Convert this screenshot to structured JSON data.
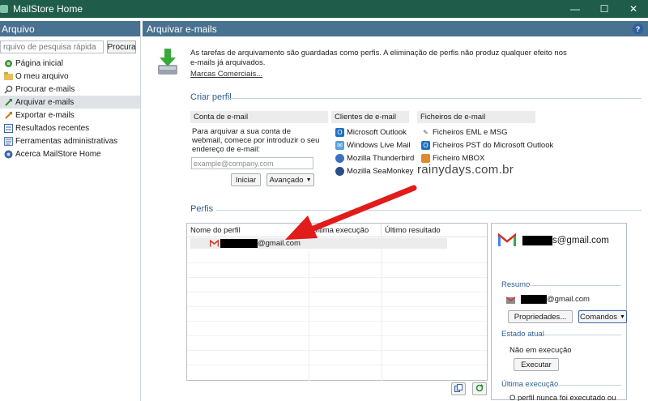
{
  "window": {
    "title": "MailStore Home",
    "controls": [
      "—",
      "☐",
      "✕"
    ]
  },
  "left": {
    "header": "Arquivo",
    "search": {
      "placeholder": "rquivo de pesquisa rápida",
      "button": "Procura"
    },
    "nav": [
      {
        "label": "Página inicial",
        "icon": "home-icon",
        "selected": false
      },
      {
        "label": "O meu arquivo",
        "icon": "folder-icon",
        "selected": false
      },
      {
        "label": "Procurar e-mails",
        "icon": "search-icon",
        "selected": false
      },
      {
        "label": "Arquivar e-mails",
        "icon": "archive-icon",
        "selected": true
      },
      {
        "label": "Exportar e-mails",
        "icon": "export-icon",
        "selected": false
      },
      {
        "label": "Resultados recentes",
        "icon": "results-icon",
        "selected": false
      },
      {
        "label": "Ferramentas administrativas",
        "icon": "tools-icon",
        "selected": false
      },
      {
        "label": "Acerca MailStore Home",
        "icon": "info-icon",
        "selected": false
      }
    ]
  },
  "main": {
    "header": "Arquivar e-mails",
    "help": "?",
    "intro": "As tarefas de arquivamento são guardadas como perfis. A eliminação de perfis não produz qualquer efeito nos e-mails já arquivados.",
    "trademark_link": "Marcas Comerciais...",
    "create_profile": {
      "title": "Criar perfil",
      "webmail": {
        "header": "Conta de e-mail",
        "text": "Para arquivar a sua conta de webmail, comece por introduzir o seu endereço de e-mail:",
        "placeholder": "example@company.com",
        "start": "Iniciar",
        "advanced": "Avançado"
      },
      "clients": {
        "header": "Clientes de e-mail",
        "items": [
          "Microsoft Outlook",
          "Windows Live Mail",
          "Mozilla Thunderbird",
          "Mozilla SeaMonkey"
        ]
      },
      "files": {
        "header": "Ficheiros de e-mail",
        "items": [
          "Ficheiros EML e MSG",
          "Ficheiros PST do Microsoft Outlook",
          "Ficheiro MBOX"
        ]
      }
    },
    "watermark": "rainydays.com.br",
    "profiles": {
      "title": "Perfis",
      "columns": [
        "Nome do perfil",
        "Última execução",
        "Último resultado"
      ],
      "rows": [
        {
          "name_suffix": "@gmail.com"
        }
      ]
    },
    "detail": {
      "title_suffix": "s@gmail.com",
      "summary_title": "Resumo",
      "summary_account_suffix": "@gmail.com",
      "properties": "Propriedades...",
      "commands": "Comandos",
      "state_title": "Estado atual",
      "state": "Não em execução",
      "run": "Executar",
      "last_run_title": "Última execução",
      "last_run_text": "O perfil nunca foi executado ou não há dados disponíveis sobre a execução."
    }
  },
  "colors": {
    "titlebar": "#1f5d4a",
    "header": "#48728f",
    "section": "#2e5e8c",
    "arrow": "#e21b1b"
  }
}
